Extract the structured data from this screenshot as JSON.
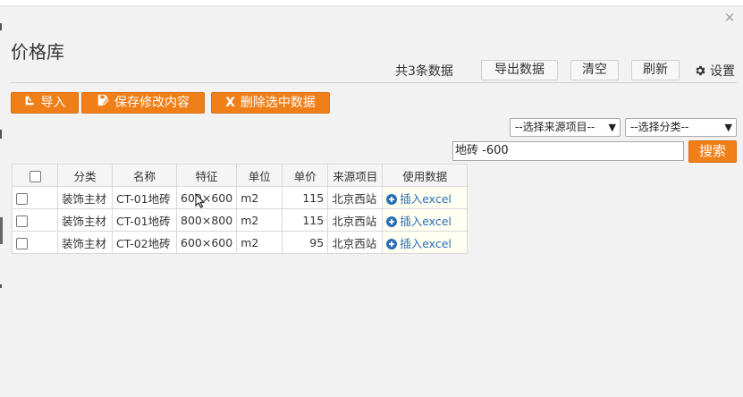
{
  "window": {
    "close_glyph": "×"
  },
  "header": {
    "title": "价格库",
    "count_text": "共3条数据",
    "export_label": "导出数据",
    "clear_label": "清空",
    "refresh_label": "刷新",
    "settings_label": "设置"
  },
  "actions": {
    "import_label": "导入",
    "save_label": "保存修改内容",
    "delete_label": "删除选中数据",
    "delete_icon": "X"
  },
  "filters": {
    "source_select": "--选择来源项目--",
    "category_select": "--选择分类--",
    "search_value": "地砖 -600",
    "search_label": "搜索"
  },
  "table": {
    "headers": [
      "分类",
      "名称",
      "特征",
      "单位",
      "单价",
      "来源项目",
      "使用数据"
    ],
    "rows": [
      {
        "category": "装饰主材",
        "name": "CT-01地砖",
        "spec": "600×600",
        "unit": "m2",
        "price": "115",
        "source": "北京西站",
        "action": "插入excel"
      },
      {
        "category": "装饰主材",
        "name": "CT-01地砖",
        "spec": "800×800",
        "unit": "m2",
        "price": "115",
        "source": "北京西站",
        "action": "插入excel"
      },
      {
        "category": "装饰主材",
        "name": "CT-02地砖",
        "spec": "600×600",
        "unit": "m2",
        "price": "95",
        "source": "北京西站",
        "action": "插入excel"
      }
    ]
  },
  "colors": {
    "accent_orange": "#f07f18",
    "link_blue": "#2a6fb5",
    "background": "#f2f2f2"
  }
}
